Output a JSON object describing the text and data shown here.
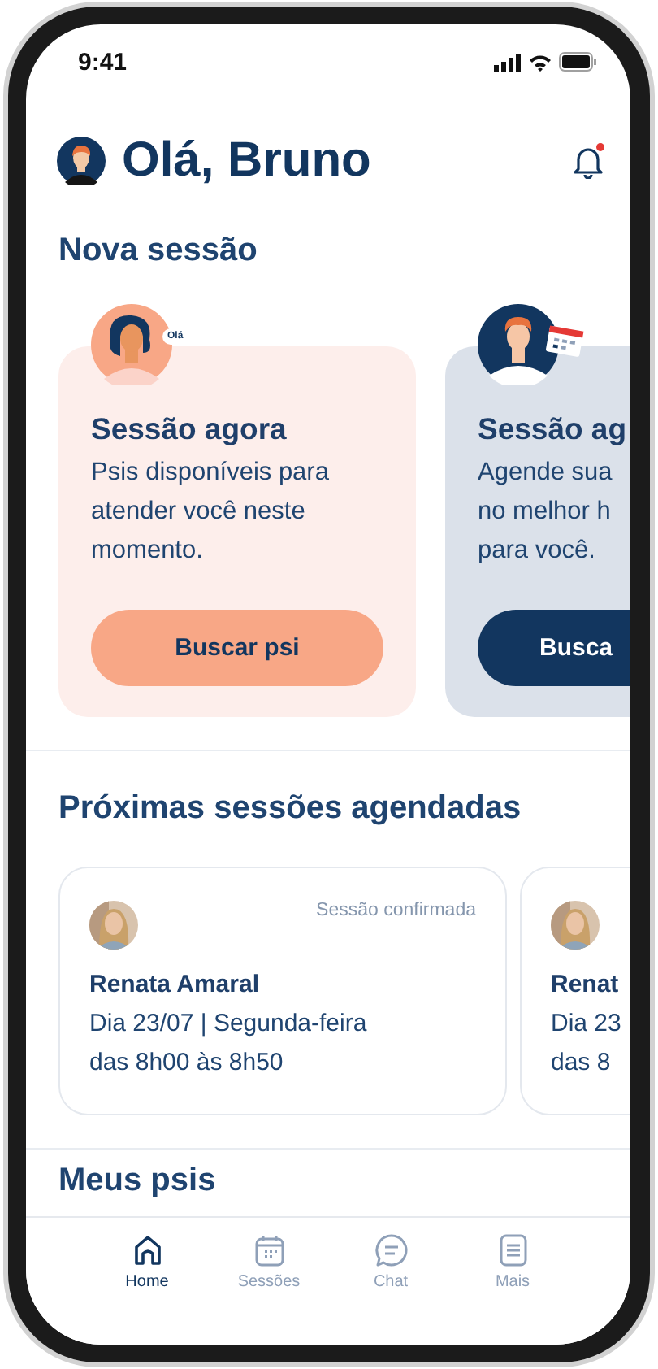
{
  "status_bar": {
    "time": "9:41"
  },
  "header": {
    "greeting": "Olá, Bruno",
    "notification_dot": true
  },
  "new_session": {
    "title": "Nova sessão",
    "cards": [
      {
        "kind": "now",
        "bubble_text": "Olá",
        "title": "Sessão agora",
        "text": "Psis disponíveis para\natender você neste\nmomento.",
        "button": "Buscar psi"
      },
      {
        "kind": "schedule",
        "title": "Sessão ag",
        "text": "Agende sua\nno melhor h\npara você.",
        "button": "Busca"
      }
    ]
  },
  "upcoming": {
    "title": "Próximas sessões agendadas",
    "sessions": [
      {
        "status": "Sessão confirmada",
        "name": "Renata Amaral",
        "text": "Dia 23/07 | Segunda-feira\ndas 8h00 às 8h50"
      },
      {
        "name": "Renat",
        "text": "Dia 23\ndas 8"
      }
    ]
  },
  "my_psis": {
    "title": "Meus psis"
  },
  "nav": [
    {
      "kind": "home",
      "label": "Home",
      "selected": true
    },
    {
      "kind": "calendar",
      "label": "Sessões",
      "selected": false
    },
    {
      "kind": "chat",
      "label": "Chat",
      "selected": false
    },
    {
      "kind": "menu",
      "label": "Mais",
      "selected": false
    }
  ]
}
